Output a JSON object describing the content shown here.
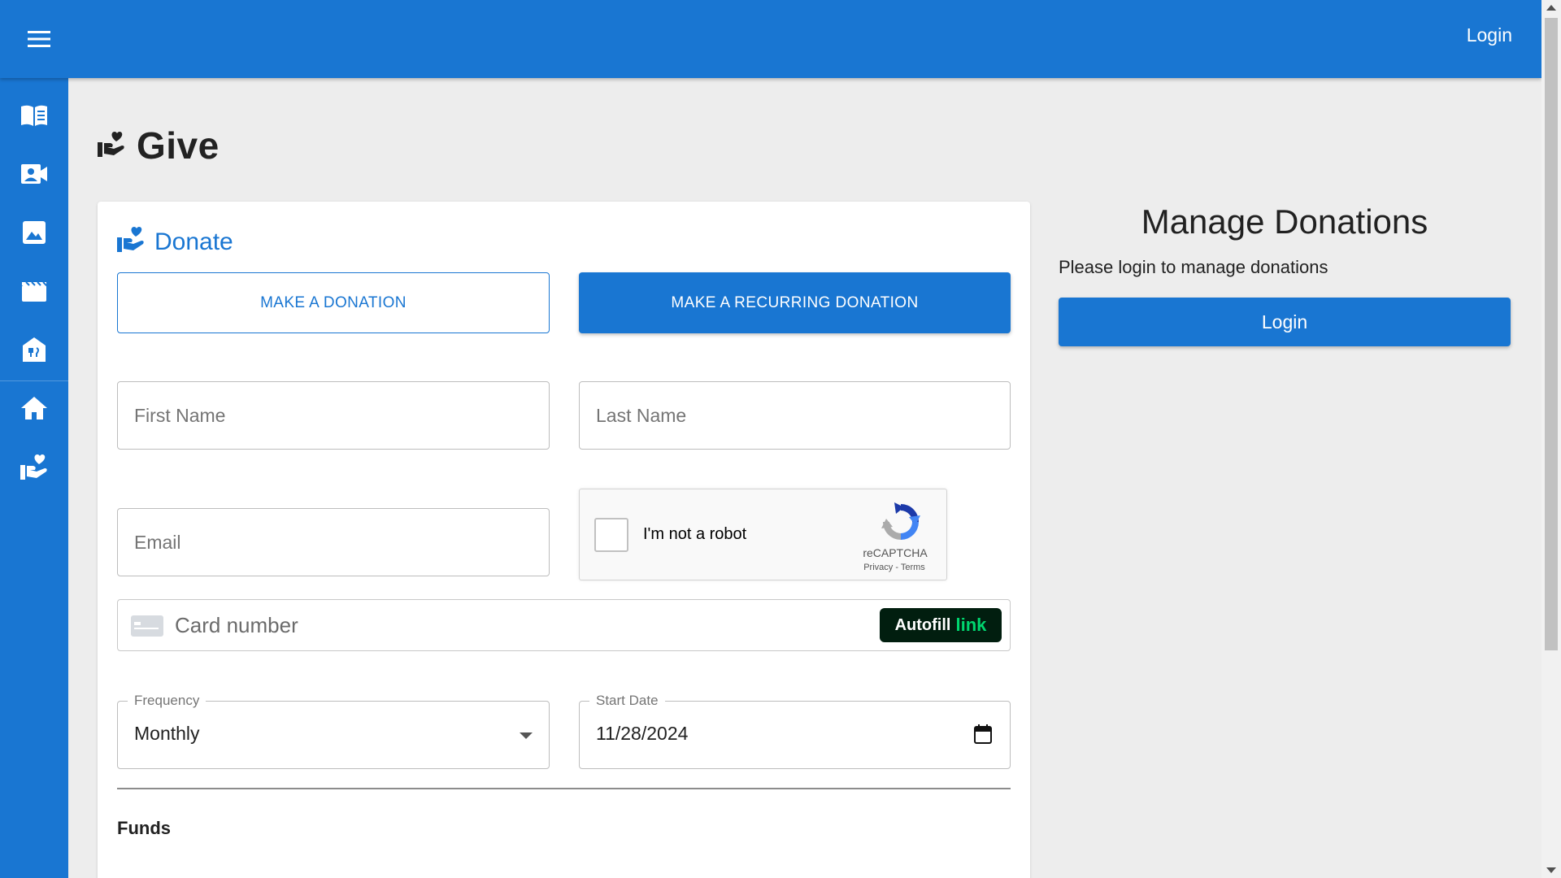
{
  "header": {
    "login_label": "Login",
    "menu_icon": "hamburger-menu-icon"
  },
  "sidebar": {
    "items": [
      {
        "name": "bible",
        "icon": "book-icon"
      },
      {
        "name": "stream",
        "icon": "video-call-icon"
      },
      {
        "name": "photos",
        "icon": "image-icon"
      },
      {
        "name": "videos",
        "icon": "movie-icon"
      },
      {
        "name": "church",
        "icon": "food-bank-icon"
      },
      {
        "name": "home",
        "icon": "home-icon"
      },
      {
        "name": "give",
        "icon": "volunteer-activism-icon"
      }
    ]
  },
  "page": {
    "title": "Give",
    "title_icon": "volunteer-activism-icon"
  },
  "donate": {
    "title": "Donate",
    "make_donation_label": "MAKE A DONATION",
    "make_recurring_label": "MAKE A RECURRING DONATION",
    "first_name_placeholder": "First Name",
    "last_name_placeholder": "Last Name",
    "email_placeholder": "Email",
    "captcha": {
      "label": "I'm not a robot",
      "brand": "reCAPTCHA",
      "privacy": "Privacy",
      "separator": " - ",
      "terms": "Terms"
    },
    "card": {
      "placeholder": "Card number",
      "autofill_label": "Autofill",
      "autofill_link": "link"
    },
    "frequency": {
      "label": "Frequency",
      "value": "Monthly"
    },
    "start_date": {
      "label": "Start Date",
      "value": "11/28/2024"
    },
    "funds_label": "Funds"
  },
  "manage": {
    "title": "Manage Donations",
    "message": "Please login to manage donations",
    "login_label": "Login"
  },
  "colors": {
    "primary": "#1976d2",
    "background": "#ededed",
    "link_green": "#00d66f"
  }
}
